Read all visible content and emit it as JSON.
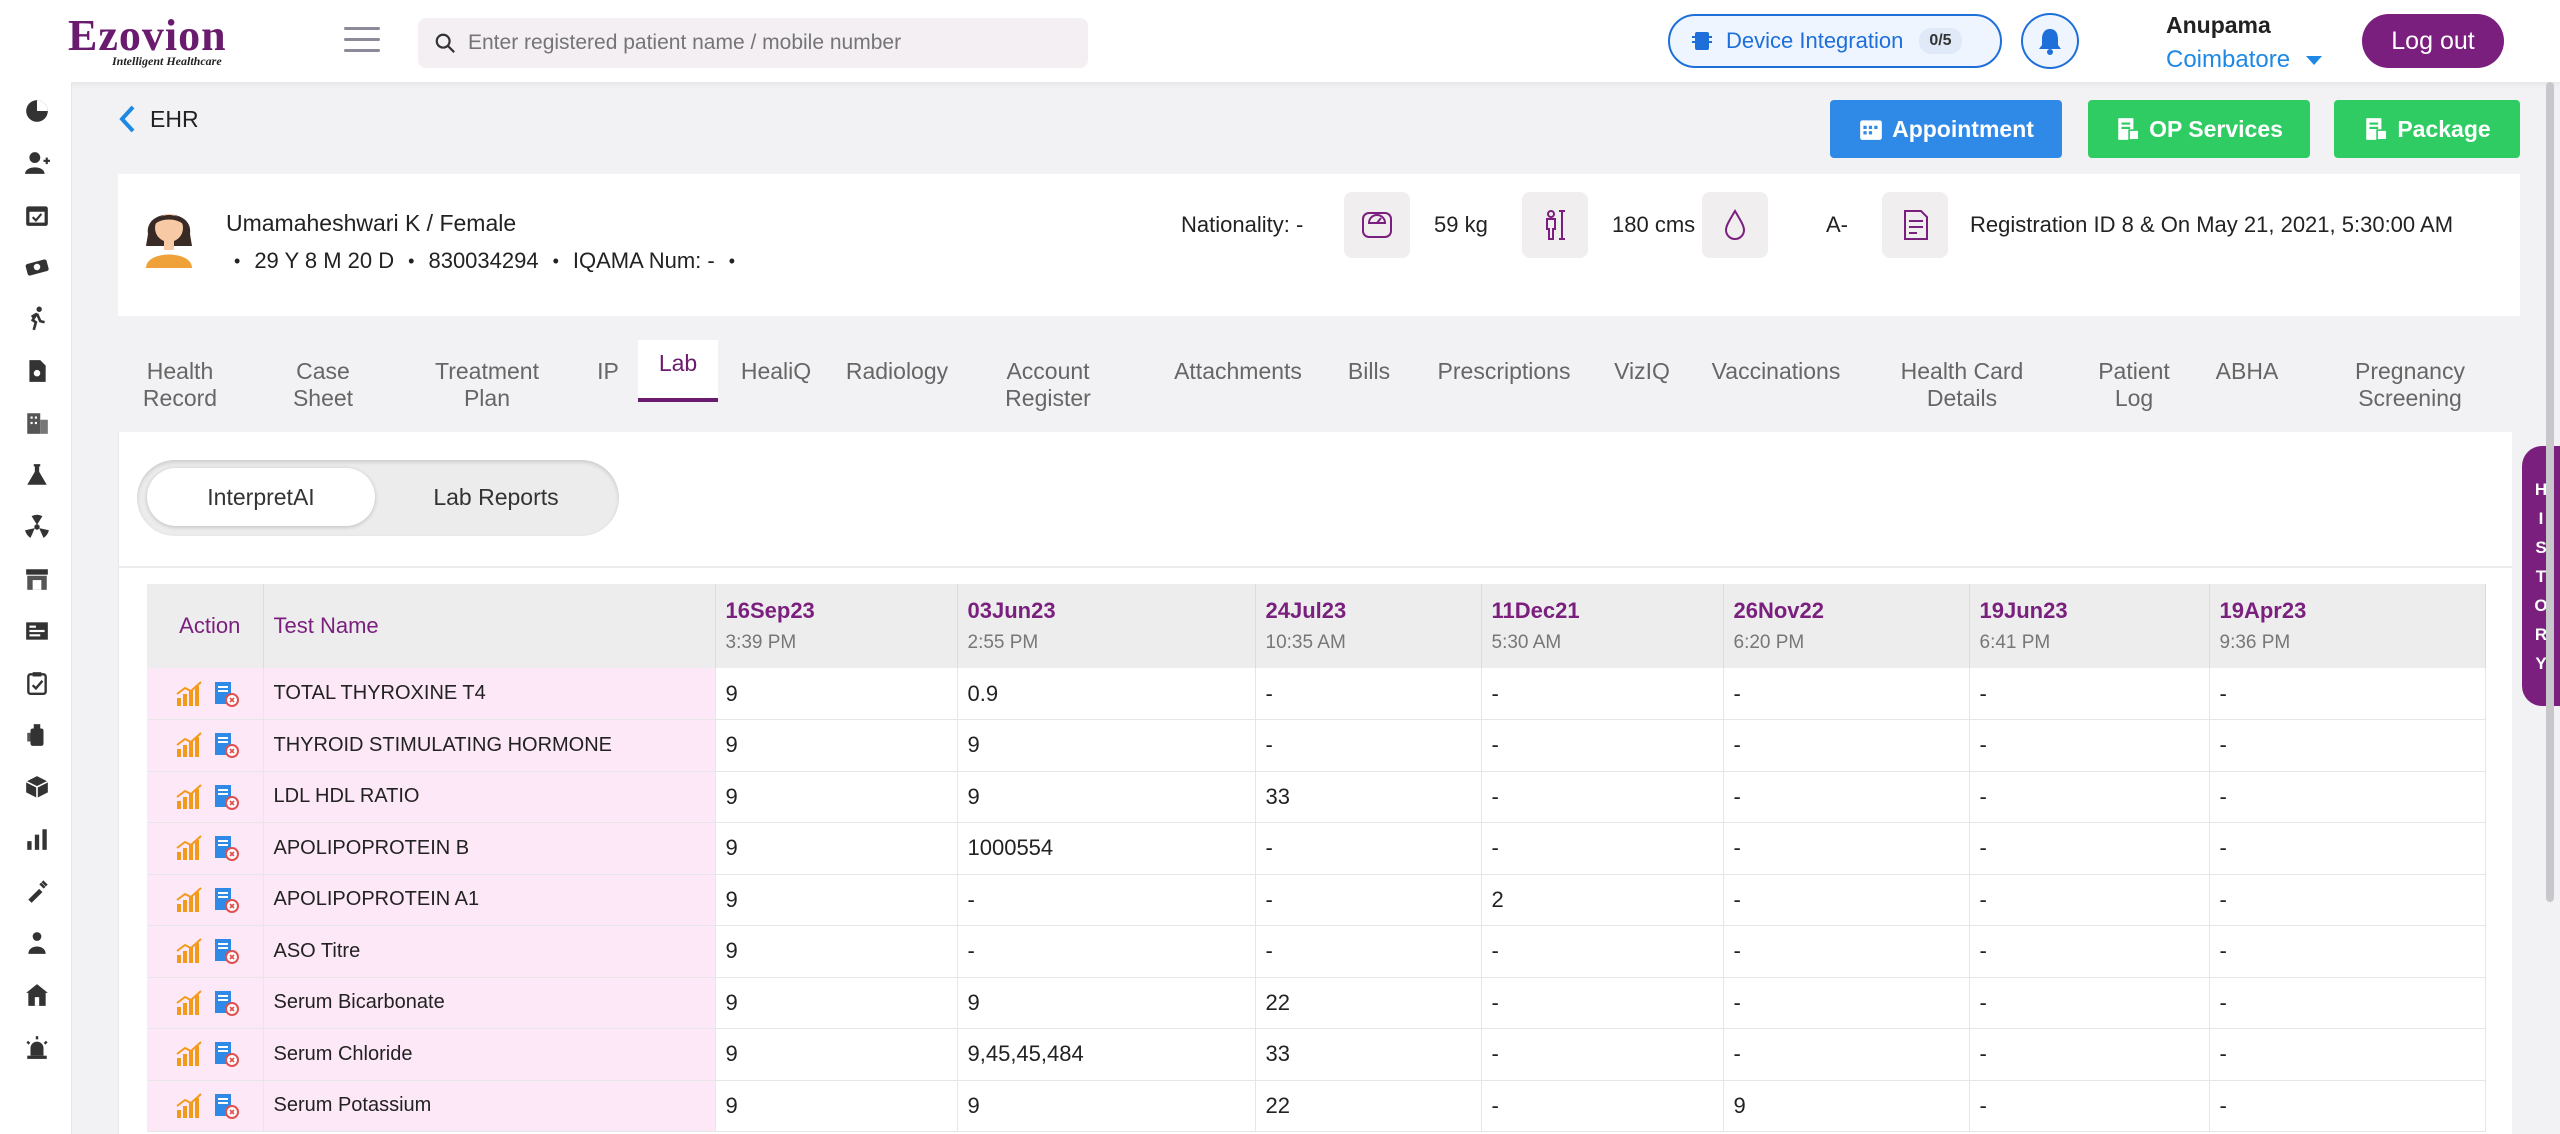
{
  "app": {
    "logo_main": "Ezovion",
    "logo_sub": "Intelligent Healthcare",
    "search_placeholder": "Enter registered patient name / mobile number",
    "device_integration_label": "Device Integration",
    "device_count": "0/5",
    "user_name": "Anupama",
    "user_location": "Coimbatore",
    "logout_label": "Log out"
  },
  "sidebar": {
    "icons": [
      "dashboard-icon",
      "add-user-icon",
      "calendar-icon",
      "tickets-icon",
      "walking-icon",
      "document-icon",
      "building-icon",
      "flask-icon",
      "radiation-icon",
      "store-icon",
      "billing-icon",
      "clipboard-icon",
      "bottle-icon",
      "package-icon",
      "chart-icon",
      "injection-icon",
      "person-icon",
      "home-icon",
      "emergency-icon"
    ]
  },
  "header": {
    "back_label": "EHR",
    "appointment_label": "Appointment",
    "op_services_label": "OP Services",
    "package_label": "Package",
    "button_colors": {
      "appointment": "#2e8ae6",
      "op_services": "#2ecc63",
      "package": "#2ecc63"
    }
  },
  "patient": {
    "name_gender": "Umamaheshwari K / Female",
    "age": "29 Y 8 M 20 D",
    "phone": "830034294",
    "iqama": "IQAMA Num: -",
    "nationality": "Nationality: -",
    "weight": "59 kg",
    "height": "180 cms",
    "blood_group": "A-",
    "registration": "Registration ID 8 & On May 21, 2021, 5:30:00 AM"
  },
  "tabs": [
    {
      "l1": "Health",
      "l2": "Record"
    },
    {
      "l1": "Case",
      "l2": "Sheet"
    },
    {
      "l1": "Treatment",
      "l2": "Plan"
    },
    {
      "l1": "IP",
      "l2": ""
    },
    {
      "l1": "Lab",
      "l2": "",
      "active": true
    },
    {
      "l1": "HealiQ",
      "l2": ""
    },
    {
      "l1": "Radiology",
      "l2": ""
    },
    {
      "l1": "Account",
      "l2": "Register"
    },
    {
      "l1": "Attachments",
      "l2": ""
    },
    {
      "l1": "Bills",
      "l2": ""
    },
    {
      "l1": "Prescriptions",
      "l2": ""
    },
    {
      "l1": "VizIQ",
      "l2": ""
    },
    {
      "l1": "Vaccinations",
      "l2": ""
    },
    {
      "l1": "Health Card",
      "l2": "Details"
    },
    {
      "l1": "Patient",
      "l2": "Log"
    },
    {
      "l1": "ABHA",
      "l2": ""
    },
    {
      "l1": "Pregnancy",
      "l2": "Screening"
    }
  ],
  "segment": {
    "interpret": "InterpretAI",
    "lab_reports": "Lab Reports"
  },
  "table": {
    "action_header": "Action",
    "test_header": "Test Name",
    "dates": [
      {
        "date": "16Sep23",
        "time": "3:39 PM"
      },
      {
        "date": "03Jun23",
        "time": "2:55 PM"
      },
      {
        "date": "24Jul23",
        "time": "10:35 AM"
      },
      {
        "date": "11Dec21",
        "time": "5:30 AM"
      },
      {
        "date": "26Nov22",
        "time": "6:20 PM"
      },
      {
        "date": "19Jun23",
        "time": "6:41 PM"
      },
      {
        "date": "19Apr23",
        "time": "9:36 PM"
      }
    ],
    "rows": [
      {
        "test": "TOTAL THYROXINE T4",
        "values": [
          "9",
          "0.9",
          "-",
          "-",
          "-",
          "-",
          "-"
        ]
      },
      {
        "test": "THYROID STIMULATING HORMONE",
        "values": [
          "9",
          "9",
          "-",
          "-",
          "-",
          "-",
          "-"
        ]
      },
      {
        "test": "LDL HDL RATIO",
        "values": [
          "9",
          "9",
          "33",
          "-",
          "-",
          "-",
          "-"
        ]
      },
      {
        "test": "APOLIPOPROTEIN B",
        "values": [
          "9",
          "1000554",
          "-",
          "-",
          "-",
          "-",
          "-"
        ]
      },
      {
        "test": "APOLIPOPROTEIN A1",
        "values": [
          "9",
          "-",
          "-",
          "2",
          "-",
          "-",
          "-"
        ]
      },
      {
        "test": "ASO Titre",
        "values": [
          "9",
          "-",
          "-",
          "-",
          "-",
          "-",
          "-"
        ]
      },
      {
        "test": "Serum Bicarbonate",
        "values": [
          "9",
          "9",
          "22",
          "-",
          "-",
          "-",
          "-"
        ]
      },
      {
        "test": "Serum Chloride",
        "values": [
          "9",
          "9,45,45,484",
          "33",
          "-",
          "-",
          "-",
          "-"
        ]
      },
      {
        "test": "Serum Potassium",
        "values": [
          "9",
          "9",
          "22",
          "-",
          "9",
          "-",
          "-"
        ]
      }
    ]
  },
  "history_letters": [
    "H",
    "I",
    "S",
    "T",
    "O",
    "R",
    "Y"
  ],
  "colors": {
    "brand": "#7a1f7e",
    "accent_blue": "#1e88e5",
    "row_highlight": "#fde8f7"
  }
}
